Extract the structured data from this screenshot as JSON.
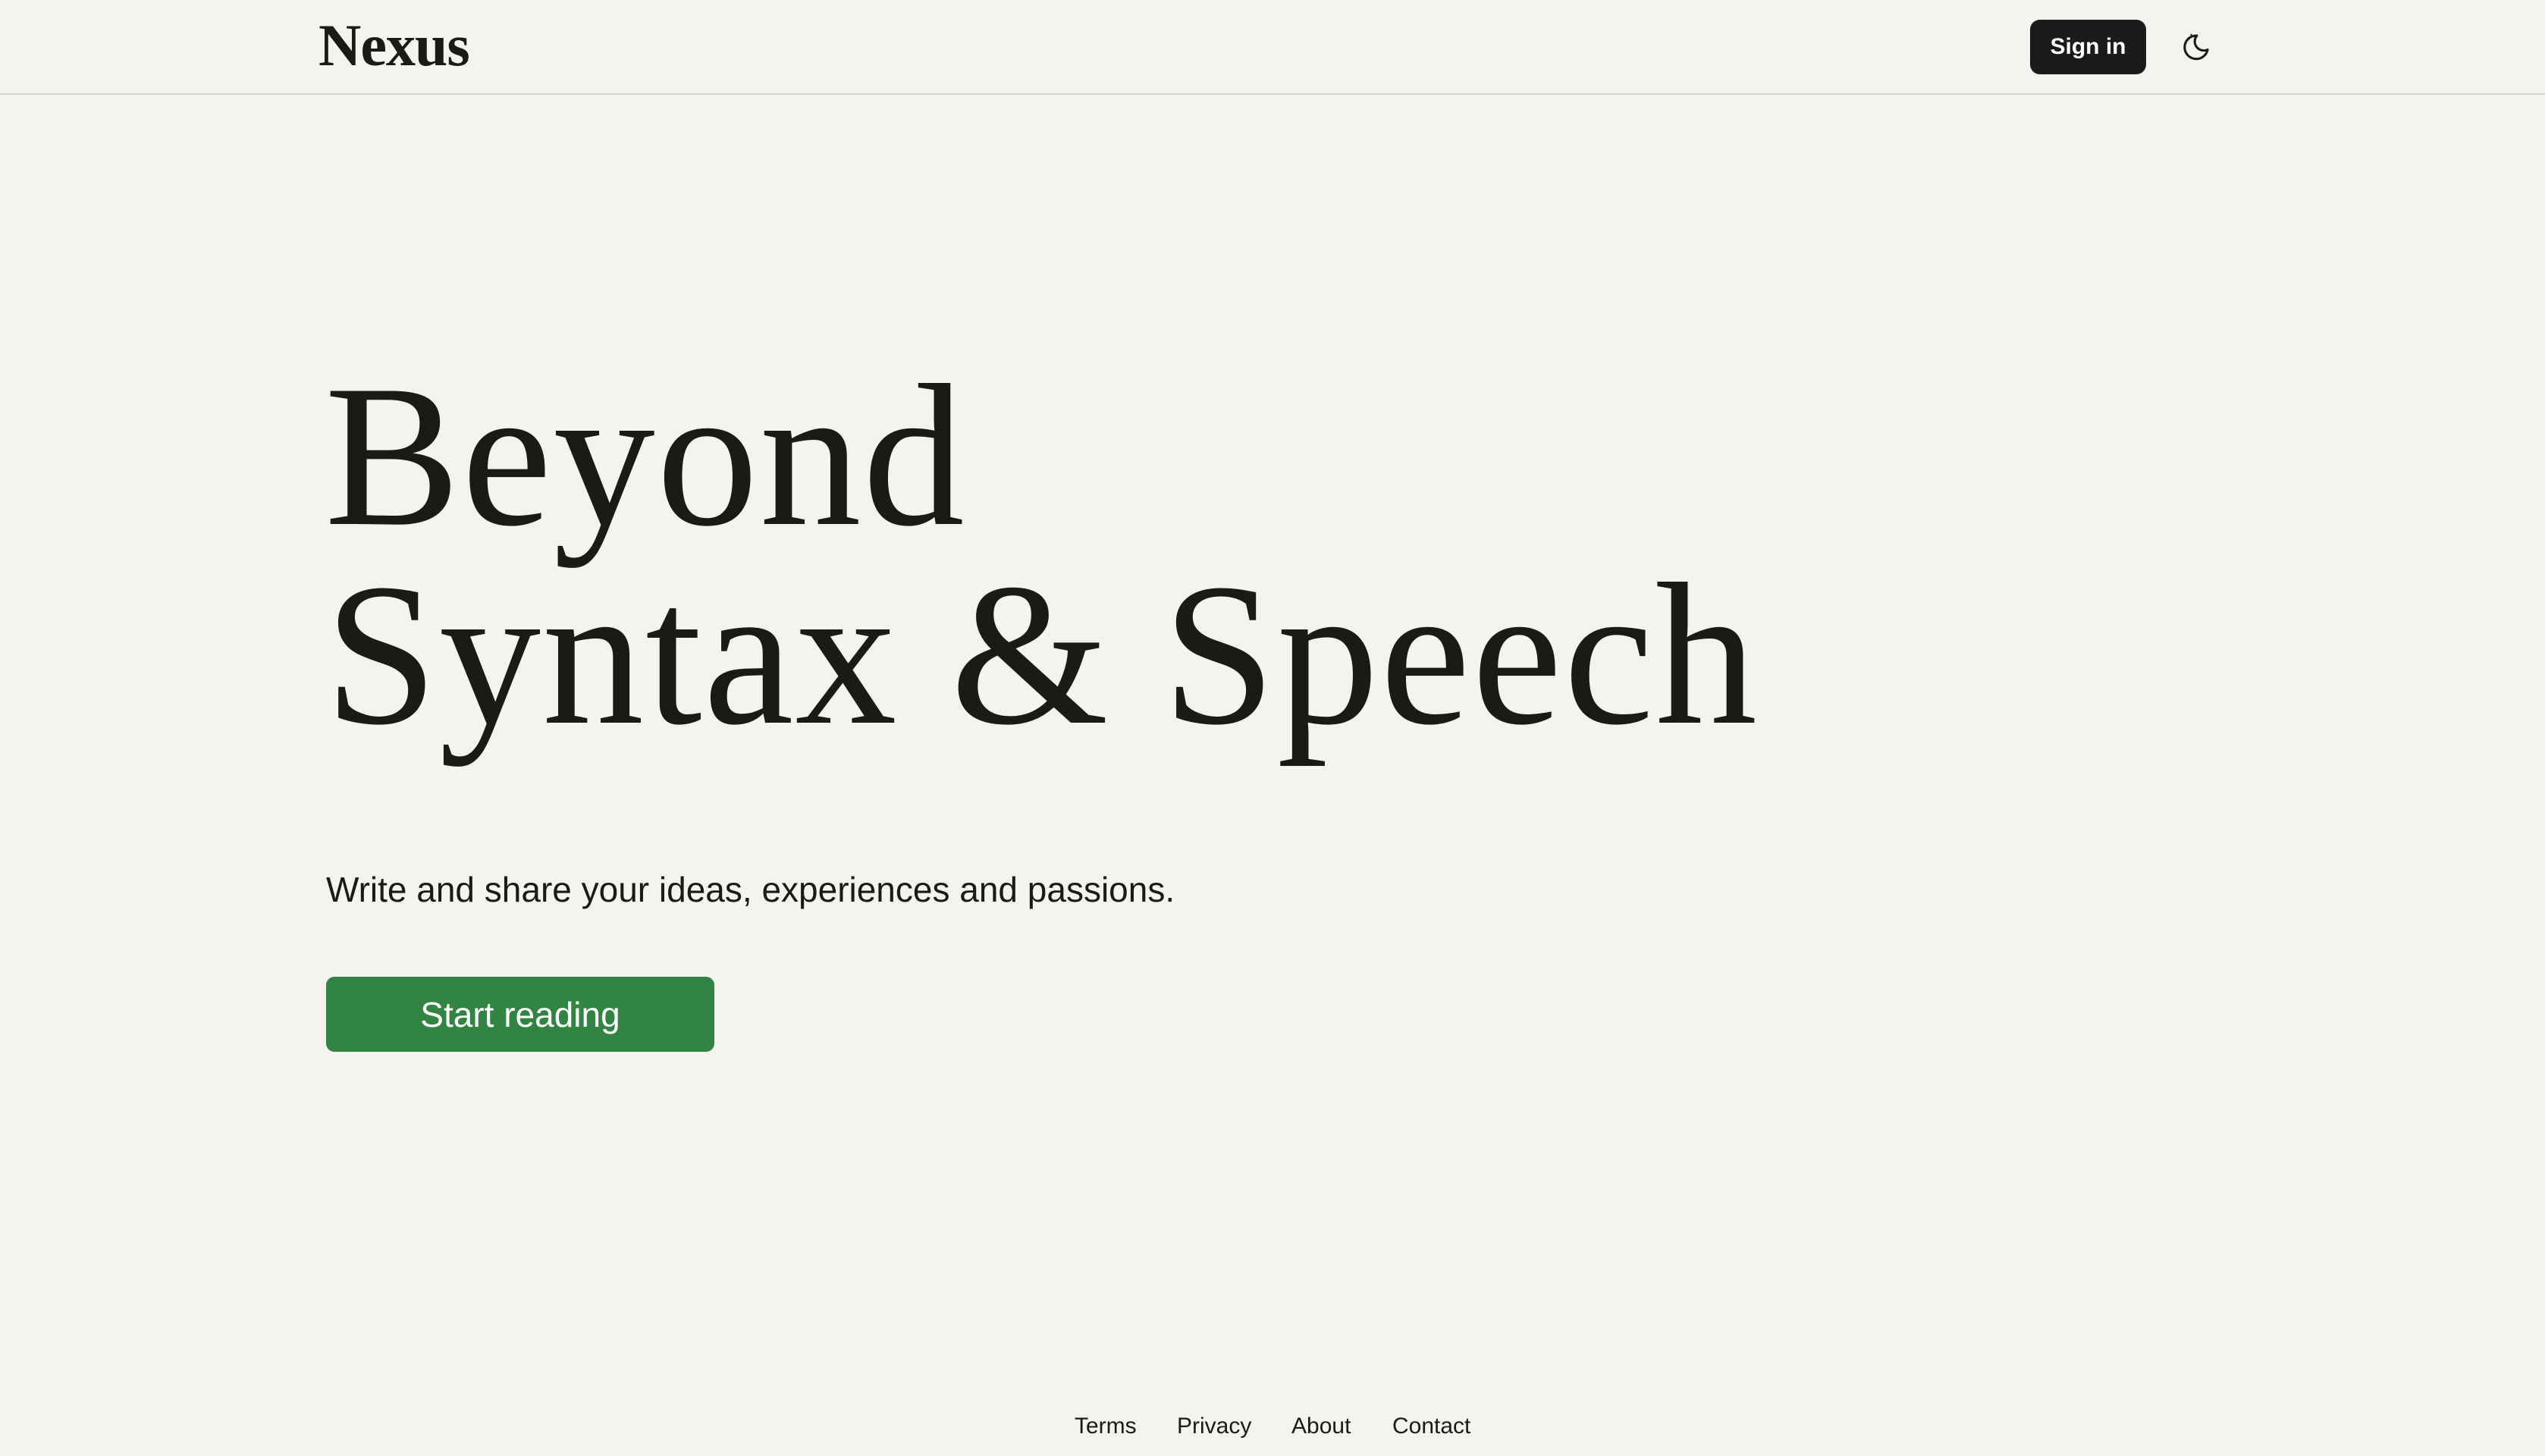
{
  "header": {
    "logo": "Nexus",
    "signin_label": "Sign in",
    "theme_toggle_icon": "moon-stars-icon"
  },
  "hero": {
    "title_line1": "Beyond",
    "title_line2": "Syntax & Speech",
    "tagline": "Write and share your ideas, experiences and passions.",
    "cta_label": "Start reading"
  },
  "footer": {
    "links": [
      {
        "label": "Terms"
      },
      {
        "label": "Privacy"
      },
      {
        "label": "About"
      },
      {
        "label": "Contact"
      }
    ]
  },
  "colors": {
    "background": "#f4f3ef",
    "text": "#1a1a17",
    "signin_bg": "#1b1b1b",
    "cta_bg": "#318441",
    "divider": "#d4d3ce"
  }
}
